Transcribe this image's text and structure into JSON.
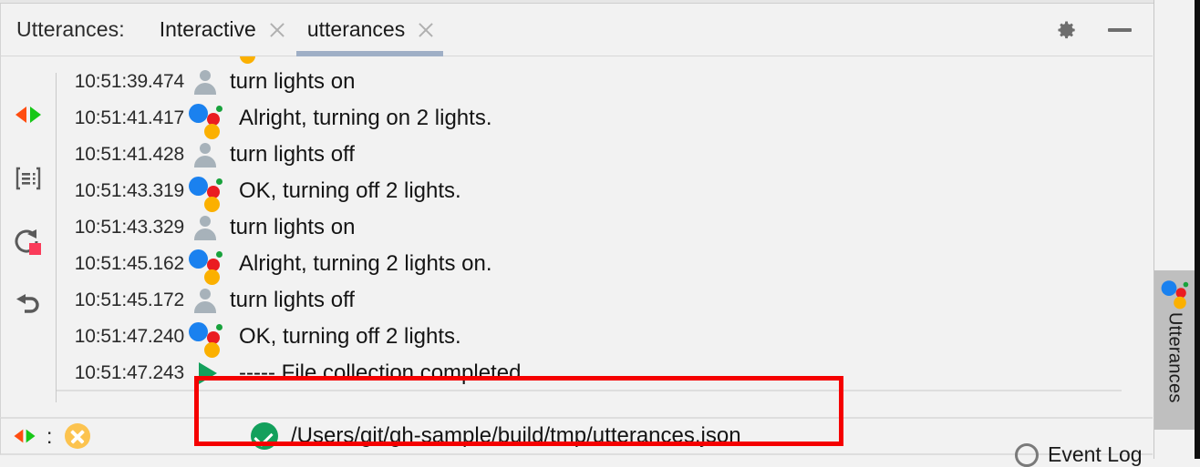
{
  "header": {
    "title": "Utterances:",
    "tabs": [
      {
        "label": "Interactive",
        "close_icon": "close-icon",
        "active": false
      },
      {
        "label": "utterances",
        "close_icon": "close-icon",
        "active": true
      }
    ],
    "settings_icon": "gear-icon",
    "minimize_icon": "minimize-icon"
  },
  "toolbar": {
    "buttons": [
      {
        "name": "expand-collapse-icon",
        "title": "Expand / Collapse"
      },
      {
        "name": "print-output-icon",
        "title": "Print Output"
      },
      {
        "name": "rerun-stop-icon",
        "title": "Rerun / Stop"
      },
      {
        "name": "undo-icon",
        "title": "Undo"
      }
    ]
  },
  "log": {
    "rows": [
      {
        "time": "10:51:39.474",
        "icon": "person-icon",
        "speaker": "user",
        "text": "turn lights on"
      },
      {
        "time": "10:51:41.417",
        "icon": "google-assistant-icon",
        "speaker": "assistant",
        "text": "Alright, turning on 2 lights."
      },
      {
        "time": "10:51:41.428",
        "icon": "person-icon",
        "speaker": "user",
        "text": "turn lights off"
      },
      {
        "time": "10:51:43.319",
        "icon": "google-assistant-icon",
        "speaker": "assistant",
        "text": "OK, turning off 2 lights."
      },
      {
        "time": "10:51:43.329",
        "icon": "person-icon",
        "speaker": "user",
        "text": "turn lights on"
      },
      {
        "time": "10:51:45.162",
        "icon": "google-assistant-icon",
        "speaker": "assistant",
        "text": "Alright, turning 2 lights on."
      },
      {
        "time": "10:51:45.172",
        "icon": "person-icon",
        "speaker": "user",
        "text": "turn lights off"
      },
      {
        "time": "10:51:47.240",
        "icon": "google-assistant-icon",
        "speaker": "assistant",
        "text": "OK, turning off 2 lights."
      },
      {
        "time": "10:51:47.243",
        "icon": "play-triangle-icon",
        "speaker": "system",
        "text": "----- File collection completed"
      }
    ]
  },
  "statusbar": {
    "expand_icon": "expand-collapse-icon",
    "separator": ":",
    "error_icon": "error-circle-icon",
    "result_icon": "success-check-icon",
    "result_path": "/Users/git/gh-sample/build/tmp/utterances.json"
  },
  "right_tool_tab": {
    "icon": "google-assistant-icon",
    "label": "Utterances"
  },
  "event_log": {
    "icon": "event-log-icon",
    "label": "Event Log"
  },
  "annotation": {
    "highlight_color": "#f50000",
    "shape": "rectangle"
  },
  "colors": {
    "background": "#f2f2f2",
    "active_tab_underline": "#9fafc6",
    "assistant_blue": "#1a81ef",
    "assistant_red": "#ea1c21",
    "assistant_yellow": "#fbb000",
    "assistant_green": "#18a23c",
    "success_green": "#13a05c",
    "warning_orange": "#fcc34f"
  }
}
